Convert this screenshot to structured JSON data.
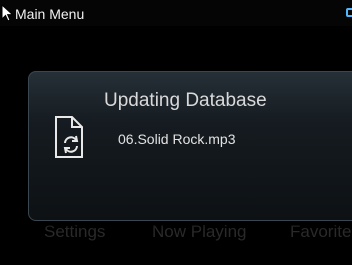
{
  "status_bar": {
    "title": "Main Menu"
  },
  "menu": {
    "items": [
      {
        "label": "Settings"
      },
      {
        "label": "Now Playing"
      },
      {
        "label": "Favorites"
      }
    ]
  },
  "dialog": {
    "title": "Updating Database",
    "file_name": "06.Solid Rock.mp3",
    "icon": "file-sync-icon"
  },
  "colors": {
    "battery_accent": "#4db8ff",
    "background": "#000000"
  }
}
